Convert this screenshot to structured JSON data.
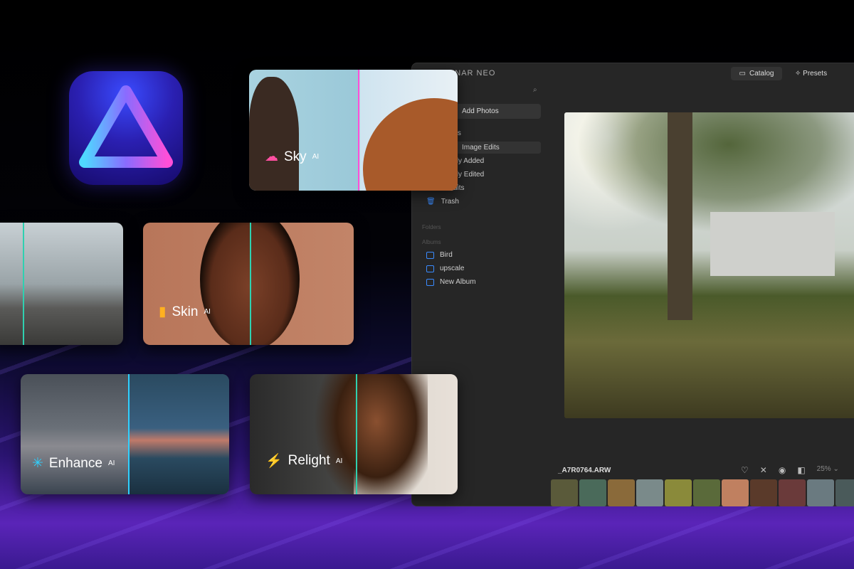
{
  "app": {
    "brand": "LUMINAR NEO",
    "header": {
      "catalog": "Catalog",
      "presets": "Presets"
    },
    "sidebar": {
      "add_photos": "Add Photos",
      "items": [
        "otos",
        "Image Edits",
        "tly Added",
        "tly Edited",
        "dits",
        "Trash"
      ],
      "folders_label": "Folders",
      "albums_label": "Albums",
      "albums": [
        "Bird",
        "upscale",
        "New Album"
      ]
    },
    "viewer": {
      "filename": "_A7R0764.ARW",
      "zoom": "25%"
    }
  },
  "features": [
    {
      "name": "Sky",
      "sup": "AI",
      "icon": "cloud-icon",
      "color": "#ff4fa0"
    },
    {
      "name": "Skin",
      "sup": "AI",
      "icon": "bottle-icon",
      "color": "#ffb020"
    },
    {
      "name": "Enhance",
      "sup": "AI",
      "icon": "sparkle-icon",
      "color": "#2fd0ff"
    },
    {
      "name": "Relight",
      "sup": "AI",
      "icon": "bolt-icon",
      "color": "#ff4fa0"
    }
  ]
}
